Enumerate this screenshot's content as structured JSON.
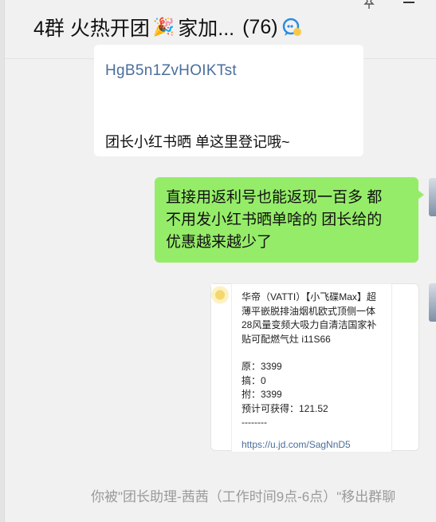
{
  "header": {
    "group_prefix": "4群 火热开团",
    "group_suffix": "家加...",
    "member_count": "(76)"
  },
  "messages": {
    "card_top": {
      "link_text": "HgB5n1ZvHOIKTst",
      "note": "团长小红书晒 单这里登记哦~"
    },
    "bubble_green": {
      "line1": "直接用返利号也能返现一百多 都",
      "line2": "不用发小红书晒单啥的 团长给的",
      "line3": "优惠越来越少了"
    },
    "product": {
      "line1": "华帝（VATTI）【小飞碟Max】超",
      "line2": "薄平嵌脱排油烟机欧式顶侧一体",
      "line3": "28风量变频大吸力自清洁国家补",
      "line4": "贴可配燃气灶 i11S66",
      "price_orig": "原：3399",
      "price_disc": "搞：0",
      "price_final": "拊：3399",
      "estimate": "预计可获得：121.52",
      "separator": "--------",
      "url": "https://u.jd.com/SagNnD5"
    }
  },
  "system_note": "你被\"团长助理-茜茜（工作时间9点-6点）\"移出群聊"
}
